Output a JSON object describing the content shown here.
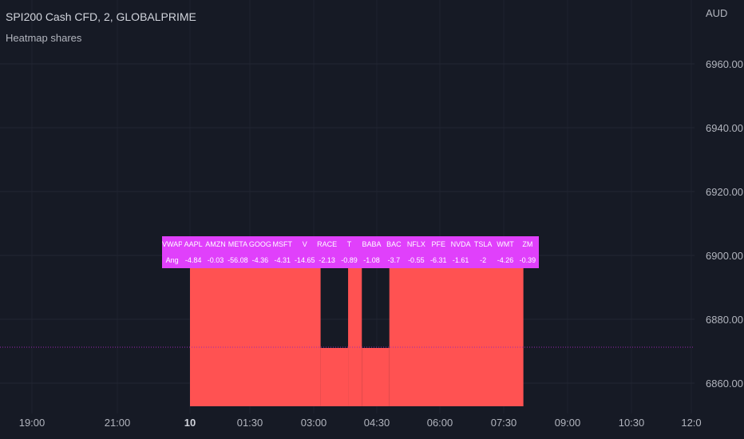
{
  "header": {
    "title": "SPI200 Cash CFD, 2, GLOBALPRIME",
    "indicator": "Heatmap shares",
    "currency": "AUD"
  },
  "heatmap_table": {
    "row_labels": [
      "VWAP",
      "Ang"
    ],
    "tickers": [
      "AAPL",
      "AMZN",
      "META",
      "GOOG",
      "MSFT",
      "V",
      "RACE",
      "T",
      "BABA",
      "BAC",
      "NFLX",
      "PFE",
      "NVDA",
      "TSLA",
      "WMT",
      "ZM"
    ],
    "values": [
      "-4.84",
      "-0.03",
      "-56.08",
      "-4.36",
      "-4.31",
      "-14.65",
      "-2.13",
      "-0.89",
      "-1.08",
      "-3.7",
      "-0.55",
      "-6.31",
      "-1.61",
      "-2",
      "-4.26",
      "-0.39"
    ],
    "background": "#e040fb"
  },
  "chart_data": {
    "type": "area",
    "x_ticks": [
      "19:00",
      "21:00",
      "10",
      "01:30",
      "03:00",
      "04:30",
      "06:00",
      "07:30",
      "09:00",
      "10:30",
      "12:0"
    ],
    "y_ticks": [
      6860,
      6880,
      6900,
      6920,
      6940,
      6960
    ],
    "y_tick_labels": [
      "6860.00",
      "6880.00",
      "6900.00",
      "6920.00",
      "6940.00",
      "6960.00"
    ],
    "ylim": [
      6851,
      6976
    ],
    "fill_color": "#ff5252",
    "background": "#161a25",
    "grid": true,
    "current_price_line": 6871,
    "blocks": [
      {
        "x_start": "00:00",
        "x_end": "03:10",
        "top": 6896
      },
      {
        "x_start": "03:10",
        "x_end": "03:50",
        "top": 6871
      },
      {
        "x_start": "03:50",
        "x_end": "04:10",
        "top": 6896
      },
      {
        "x_start": "04:10",
        "x_end": "04:50",
        "top": 6871
      },
      {
        "x_start": "04:50",
        "x_end": "08:05",
        "top": 6896
      }
    ]
  }
}
